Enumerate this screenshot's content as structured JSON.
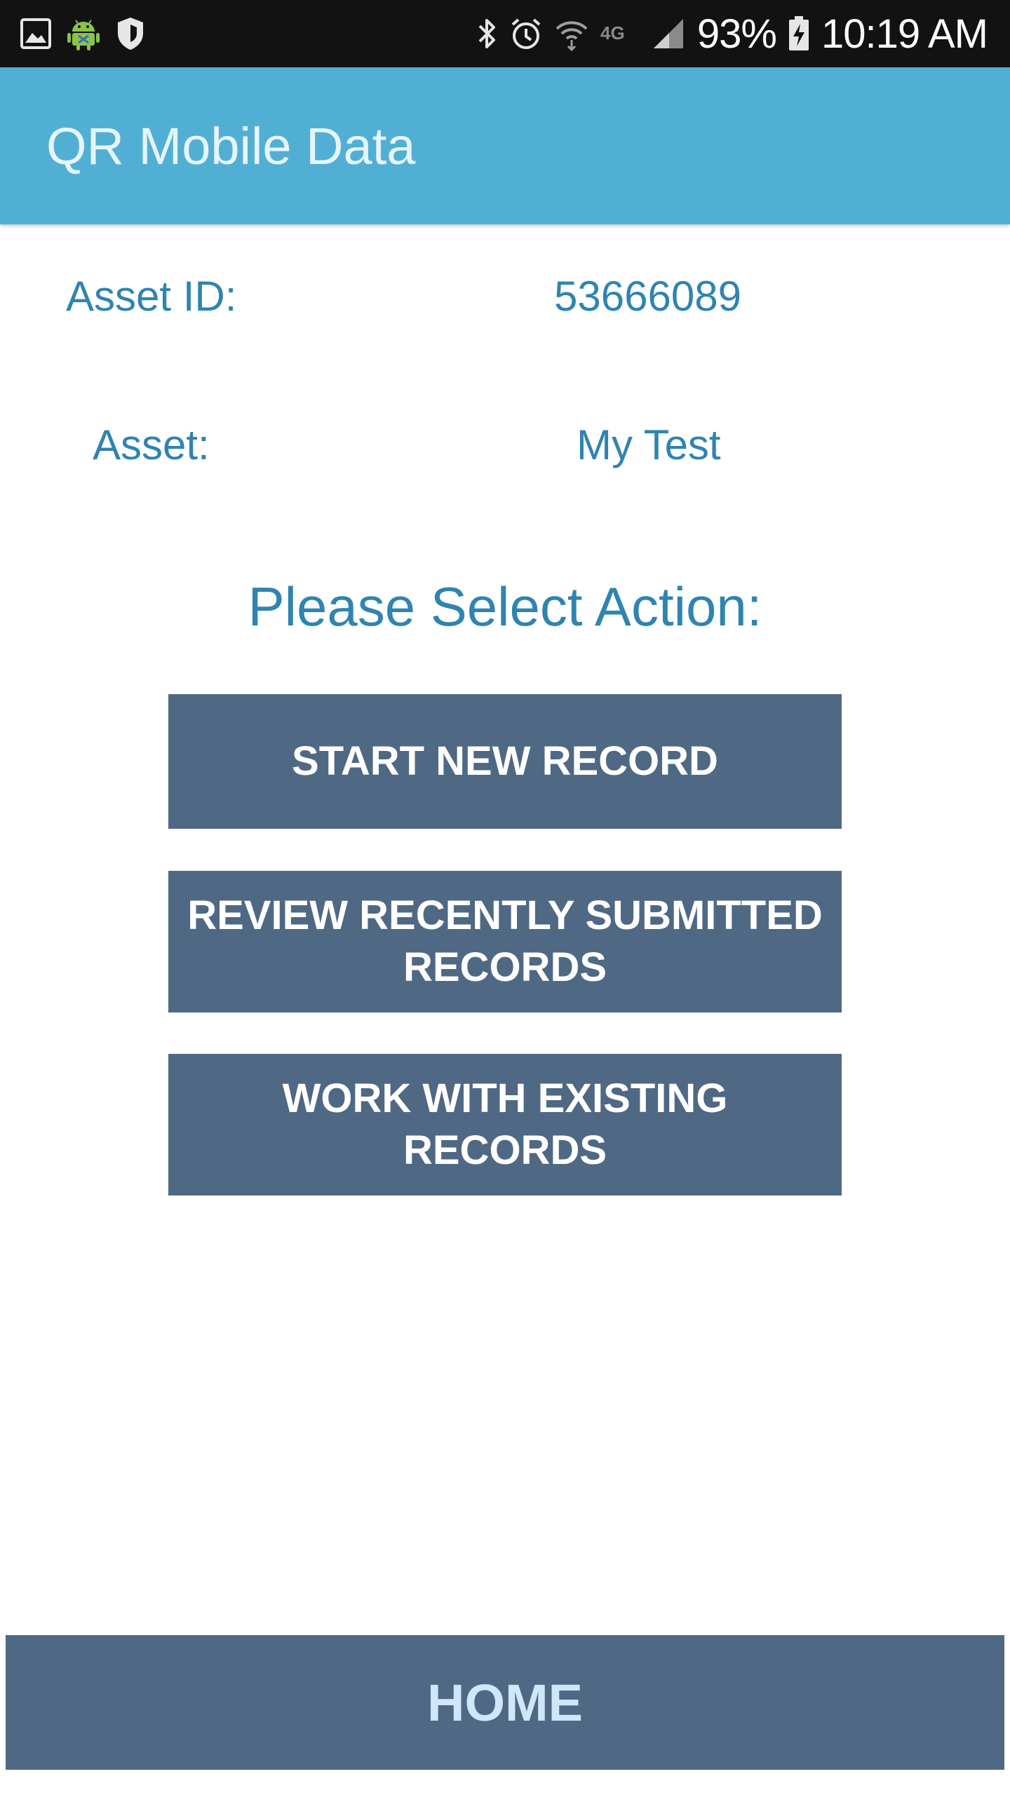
{
  "status_bar": {
    "battery": "93%",
    "time": "10:19 AM",
    "network_type": "4G",
    "icons_left": [
      "gallery-icon",
      "android-icon",
      "shield-icon"
    ],
    "icons_right": [
      "bluetooth-icon",
      "alarm-icon",
      "wifi-icon",
      "network-4g-icon",
      "signal-icon",
      "battery-icon"
    ]
  },
  "app_bar": {
    "title": "QR Mobile Data",
    "color": "#52afd4"
  },
  "info": {
    "asset_id_label": "Asset ID:",
    "asset_id_value": "53666089",
    "asset_label": "Asset:",
    "asset_value": "My Test"
  },
  "prompt": "Please Select Action:",
  "actions": [
    {
      "label": "START NEW RECORD"
    },
    {
      "label": "REVIEW RECENTLY SUBMITTED RECORDS"
    },
    {
      "label": "WORK WITH EXISTING RECORDS"
    }
  ],
  "home_label": "HOME",
  "colors": {
    "accent_text": "#2f84b0",
    "button_bg": "#4f6884",
    "status_bar_bg": "#121212"
  }
}
